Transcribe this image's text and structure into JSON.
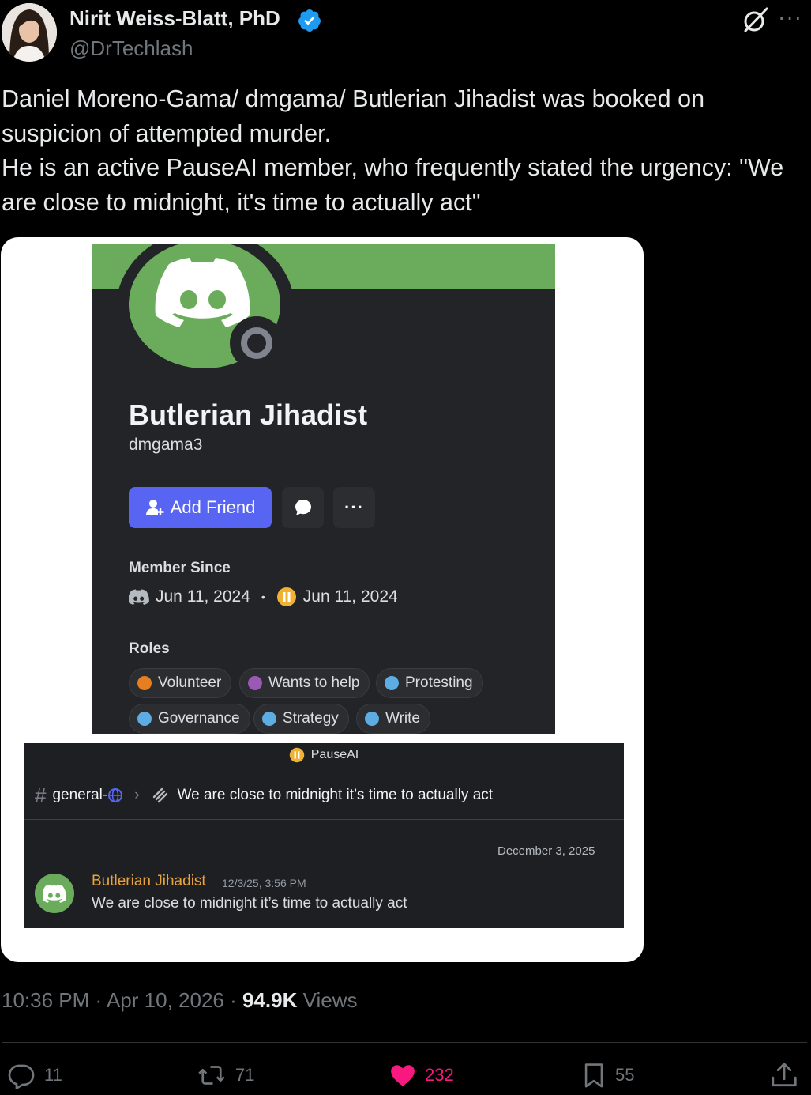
{
  "author": {
    "name": "Nirit Weiss-Blatt, PhD",
    "handle": "@DrTechlash",
    "verified_color": "#1d9bf0"
  },
  "icons": {
    "verified": "verified-badge-icon",
    "grok": "grok-icon",
    "more": "more-icon",
    "reply": "reply-icon",
    "retweet": "retweet-icon",
    "like": "heart-icon",
    "bookmark": "bookmark-icon",
    "share": "share-icon"
  },
  "more_glyph": "···",
  "tweet": {
    "lines": [
      "Daniel Moreno-Gama/ dmgama/ Butlerian Jihadist was booked on suspicion of attempted murder.",
      "He is an active PauseAI member, who frequently stated the urgency: \"We are close to midnight, it's time to actually act\""
    ]
  },
  "discord_profile": {
    "display_name": "Butlerian Jihadist",
    "username": "dmgama3",
    "add_friend_label": "Add Friend",
    "more_label": "···",
    "member_since_label": "Member Since",
    "discord_joined": "Jun 11, 2024",
    "separator": "•",
    "server_joined": "Jun 11, 2024",
    "roles_label": "Roles",
    "roles": [
      {
        "name": "Volunteer",
        "color": "#e67e22"
      },
      {
        "name": "Wants to help",
        "color": "#9b59b6"
      },
      {
        "name": "Protesting",
        "color": "#5dade2"
      },
      {
        "name": "Governance",
        "color": "#5dade2"
      },
      {
        "name": "Strategy",
        "color": "#5dade2"
      },
      {
        "name": "Write",
        "color": "#5dade2"
      }
    ],
    "banner_color": "#6aac5c",
    "accent_color": "#5865f2",
    "server_badge_color": "#f0b232"
  },
  "thread": {
    "server_name": "PauseAI",
    "channel_hash": "#",
    "channel_name": "general-",
    "breadcrumb_sep": "›",
    "thread_title": "We are close to midnight it’s time to actually act",
    "date_divider": "December 3, 2025",
    "message": {
      "author": "Butlerian Jihadist",
      "timestamp": "12/3/25, 3:56 PM",
      "text": "We are close to midnight it’s time to actually act",
      "author_color": "#e8a33a"
    }
  },
  "meta": {
    "time": "10:36 PM",
    "sep1": " · ",
    "date": "Apr 10, 2026",
    "sep2": " · ",
    "views_count": "94.9K",
    "views_label": " Views"
  },
  "actions": {
    "replies": "11",
    "reposts": "71",
    "likes": "232",
    "bookmarks": "55",
    "like_color": "#f91880"
  }
}
